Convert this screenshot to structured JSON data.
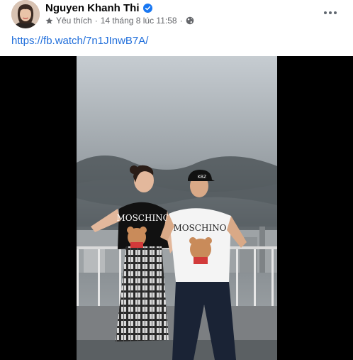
{
  "post": {
    "author": "Nguyen Khanh Thi",
    "audience_label": "Yêu thích",
    "separator": "·",
    "timestamp": "14 tháng 8 lúc 11:58",
    "link_text": "https://fb.watch/7n1JInwB7A/",
    "icons": {
      "verified": "verified-badge-icon",
      "favorites": "star-icon",
      "privacy": "globe-icon",
      "options": "more-options-icon"
    },
    "colors": {
      "link": "#216fdb",
      "verified": "#1877f2",
      "meta": "#65676b",
      "video_bg": "#000000"
    }
  },
  "video": {
    "shirt_text_left": "MOSCHINO",
    "shirt_text_right": "MOSCHINO",
    "cap_text": "KBZ"
  }
}
